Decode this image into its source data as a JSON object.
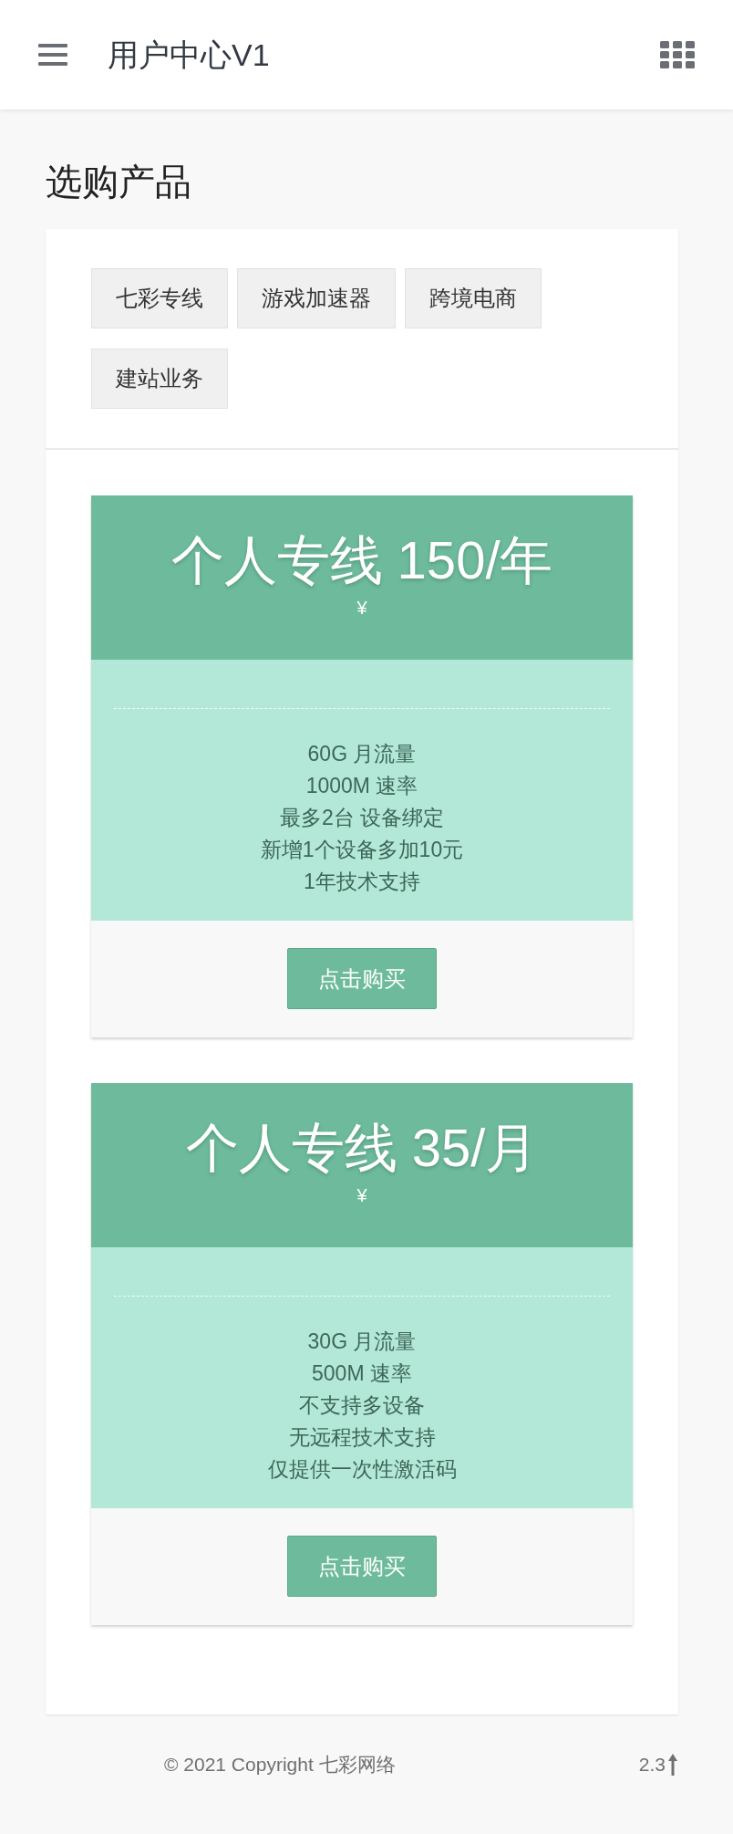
{
  "header": {
    "title": "用户中心V1"
  },
  "page_title": "选购产品",
  "categories": [
    {
      "label": "七彩专线",
      "selected": false
    },
    {
      "label": "游戏加速器",
      "selected": false
    },
    {
      "label": "跨境电商",
      "selected": false
    },
    {
      "label": "建站业务",
      "selected": false
    }
  ],
  "plans": [
    {
      "name": "个人专线 150/年",
      "currency": "¥",
      "features": [
        "60G 月流量",
        "1000M 速率",
        "最多2台 设备绑定",
        "新增1个设备多加10元",
        "1年技术支持"
      ],
      "button": "点击购买"
    },
    {
      "name": "个人专线 35/月",
      "currency": "¥",
      "features": [
        "30G 月流量",
        "500M 速率",
        "不支持多设备",
        "无远程技术支持",
        "仅提供一次性激活码"
      ],
      "button": "点击购买"
    }
  ],
  "footer": {
    "copyright": "© 2021 Copyright 七彩网络",
    "version": "2.3"
  }
}
